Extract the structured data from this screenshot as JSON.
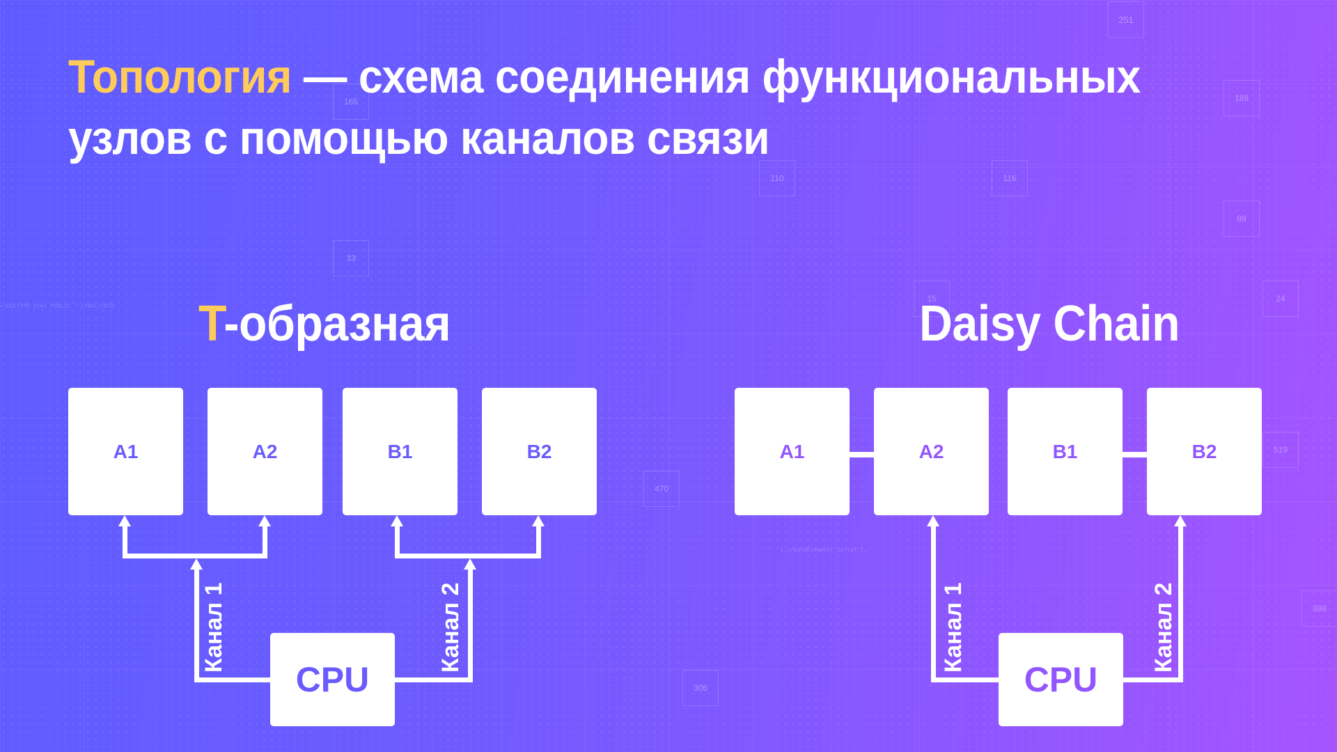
{
  "title": {
    "highlight": "Топология",
    "rest_line1": " — схема соединения функциональных",
    "line2": "узлов с помощью каналов связи"
  },
  "colors": {
    "accent_yellow": "#FFCC5C",
    "text_white": "#FFFFFF",
    "gradient_start": "#5E5CFF",
    "gradient_end": "#A654FF"
  },
  "diagrams": [
    {
      "title_highlight": "T",
      "title_rest": "-образная",
      "nodes": [
        "A1",
        "A2",
        "B1",
        "B2"
      ],
      "cpu_label": "CPU",
      "channels": [
        "Канал 1",
        "Канал 2"
      ],
      "connections": "Channel 1 branches to A1 and A2; Channel 2 branches to B1 and B2"
    },
    {
      "title": "Daisy Chain",
      "nodes": [
        "A1",
        "A2",
        "B1",
        "B2"
      ],
      "cpu_label": "CPU",
      "channels": [
        "Канал 1",
        "Канал 2"
      ],
      "connections": "Channel 1 to A2, A2 linked to A1; Channel 2 to B2, B2 linked to B1"
    }
  ],
  "background_numbers": [
    "251",
    "165",
    "188",
    "110",
    "116",
    "89",
    "33",
    "15",
    "24",
    "519",
    "470",
    "388",
    "306"
  ],
  "background_code": [
    "<!DOCTYPE html PUBLIC \"-//W3C//DTD",
    "s.createElement(\"script\");"
  ]
}
